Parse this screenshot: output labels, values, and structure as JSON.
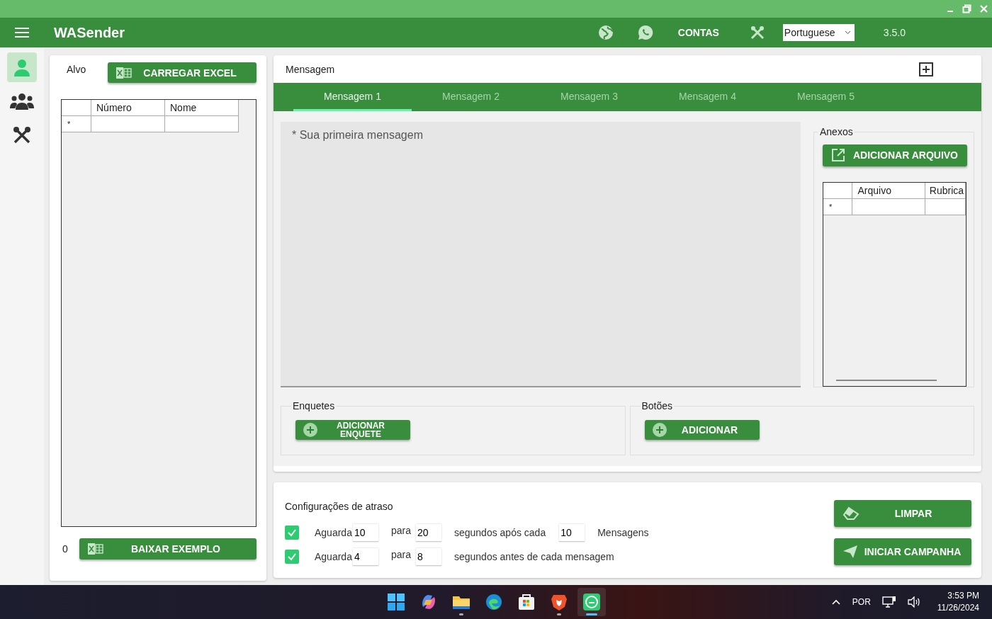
{
  "app_bar": {
    "title": "WASender",
    "contas": "CONTAS",
    "language": "Portuguese",
    "version": "3.5.0"
  },
  "sidebar": {
    "items": [
      {
        "kind": "person",
        "selected": true
      },
      {
        "kind": "group",
        "selected": false
      },
      {
        "kind": "tools",
        "selected": false
      }
    ]
  },
  "target": {
    "label": "Alvo",
    "load_button": "CARREGAR EXCEL",
    "columns": [
      "Número",
      "Nome"
    ],
    "new_row_marker": "*",
    "count": "0",
    "example_button": "BAIXAR EXEMPLO"
  },
  "message": {
    "title": "Mensagem",
    "tabs": [
      {
        "label": "Mensagem 1",
        "selected": true
      },
      {
        "label": "Mensagem 2",
        "selected": false
      },
      {
        "label": "Mensagem 3",
        "selected": false
      },
      {
        "label": "Mensagem 4",
        "selected": false
      },
      {
        "label": "Mensagem 5",
        "selected": false
      }
    ],
    "placeholder": "* Sua primeira mensagem",
    "attachments": {
      "title": "Anexos",
      "button": "ADICIONAR ARQUIVO",
      "columns": [
        "Arquivo",
        "Rubrica"
      ],
      "new_row_marker": "*"
    },
    "polls": {
      "title": "Enquetes",
      "button": "ADICIONAR ENQUETE"
    },
    "buttons_section": {
      "title": "Botões",
      "button": "ADICIONAR"
    }
  },
  "delay": {
    "title": "Configurações de atraso",
    "rows": [
      {
        "checked": true,
        "wait_label": "Aguarda",
        "from": "10",
        "to_label": "para",
        "to": "20",
        "text": "segundos após cada",
        "count": "10",
        "count_label": "Mensagens"
      },
      {
        "checked": true,
        "wait_label": "Aguarda",
        "from": "4",
        "to_label": "para",
        "to": "8",
        "text": "segundos antes de cada mensagem"
      }
    ]
  },
  "actions": [
    {
      "kind": "eraser",
      "label": "LIMPAR"
    },
    {
      "kind": "send",
      "label": "INICIAR CAMPANHA"
    }
  ],
  "taskbar": {
    "apps": [
      {
        "kind": "start",
        "running": false,
        "selected": false
      },
      {
        "kind": "copilot",
        "running": false,
        "selected": false
      },
      {
        "kind": "folder",
        "running": true,
        "selected": false
      },
      {
        "kind": "edge",
        "running": false,
        "selected": false
      },
      {
        "kind": "store",
        "running": false,
        "selected": false
      },
      {
        "kind": "brave",
        "running": true,
        "selected": false
      },
      {
        "kind": "wasender",
        "running": true,
        "selected": true
      }
    ],
    "language": "POR",
    "time": "3:53 PM",
    "date": "11/26/2024"
  }
}
